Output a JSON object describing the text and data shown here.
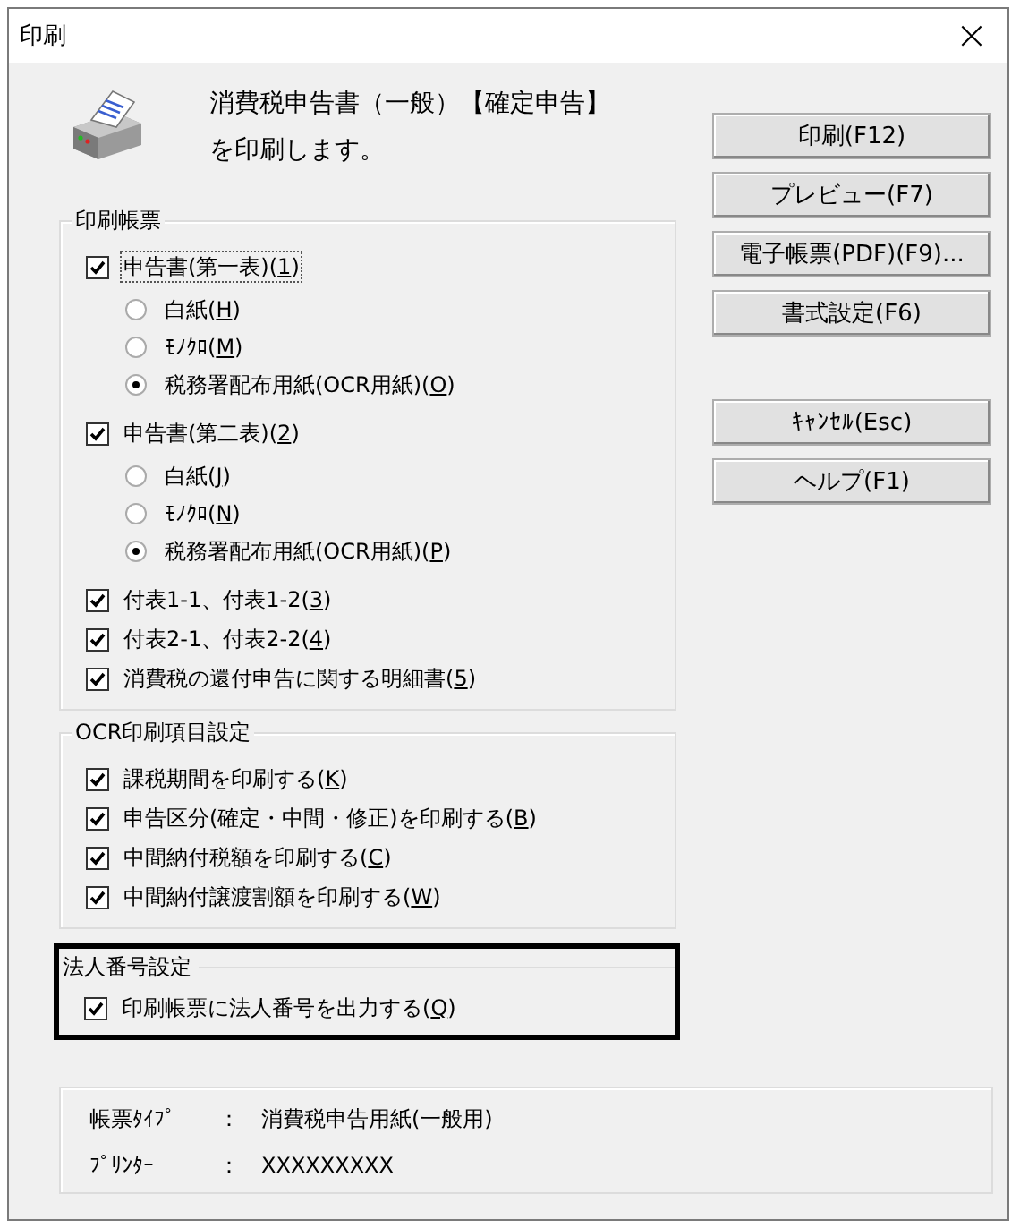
{
  "window": {
    "title": "印刷",
    "close": "×"
  },
  "message": {
    "line1": "消費税申告書（一般）【確定申告】",
    "line2": "を印刷します。"
  },
  "button_groups": [
    [
      "印刷(F12)",
      "プレビュー(F7)",
      "電子帳票(PDF)(F9)...",
      "書式設定(F6)"
    ],
    [
      "ｷｬﾝｾﾙ(Esc)",
      "ヘルプ(F1)"
    ]
  ],
  "groups": [
    {
      "title": "印刷帳票",
      "highlighted": false,
      "items": [
        {
          "label": [
            "申告書(第一表)(",
            "1",
            ")"
          ],
          "checked": true,
          "focused": true,
          "options": [
            {
              "label": [
                "白紙(",
                "H",
                ")"
              ],
              "selected": false
            },
            {
              "label": [
                "ﾓﾉｸﾛ(",
                "M",
                ")"
              ],
              "selected": false
            },
            {
              "label": [
                "税務署配布用紙(OCR用紙)(",
                "O",
                ")"
              ],
              "selected": true
            }
          ]
        },
        {
          "label": [
            "申告書(第二表)(",
            "2",
            ")"
          ],
          "checked": true,
          "focused": false,
          "options": [
            {
              "label": [
                "白紙(",
                "J",
                ")"
              ],
              "selected": false
            },
            {
              "label": [
                "ﾓﾉｸﾛ(",
                "N",
                ")"
              ],
              "selected": false
            },
            {
              "label": [
                "税務署配布用紙(OCR用紙)(",
                "P",
                ")"
              ],
              "selected": true
            }
          ]
        },
        {
          "label": [
            "付表1-1、付表1-2(",
            "3",
            ")"
          ],
          "checked": true,
          "focused": false
        },
        {
          "label": [
            "付表2-1、付表2-2(",
            "4",
            ")"
          ],
          "checked": true,
          "focused": false
        },
        {
          "label": [
            "消費税の還付申告に関する明細書(",
            "5",
            ")"
          ],
          "checked": true,
          "focused": false
        }
      ]
    },
    {
      "title": "OCR印刷項目設定",
      "highlighted": false,
      "items": [
        {
          "label": [
            "課税期間を印刷する(",
            "K",
            ")"
          ],
          "checked": true,
          "focused": false
        },
        {
          "label": [
            "申告区分(確定・中間・修正)を印刷する(",
            "B",
            ")"
          ],
          "checked": true,
          "focused": false
        },
        {
          "label": [
            "中間納付税額を印刷する(",
            "C",
            ")"
          ],
          "checked": true,
          "focused": false
        },
        {
          "label": [
            "中間納付譲渡割額を印刷する(",
            "W",
            ")"
          ],
          "checked": true,
          "focused": false
        }
      ]
    },
    {
      "title": "法人番号設定",
      "highlighted": true,
      "items": [
        {
          "label": [
            "印刷帳票に法人番号を出力する(",
            "Q",
            ")"
          ],
          "checked": true,
          "focused": false
        }
      ]
    }
  ],
  "info": [
    {
      "label": "帳票ﾀｲﾌﾟ",
      "colon": "：",
      "value": "消費税申告用紙(一般用)"
    },
    {
      "label": "ﾌﾟﾘﾝﾀｰ",
      "colon": "：",
      "value": "XXXXXXXXX"
    }
  ]
}
